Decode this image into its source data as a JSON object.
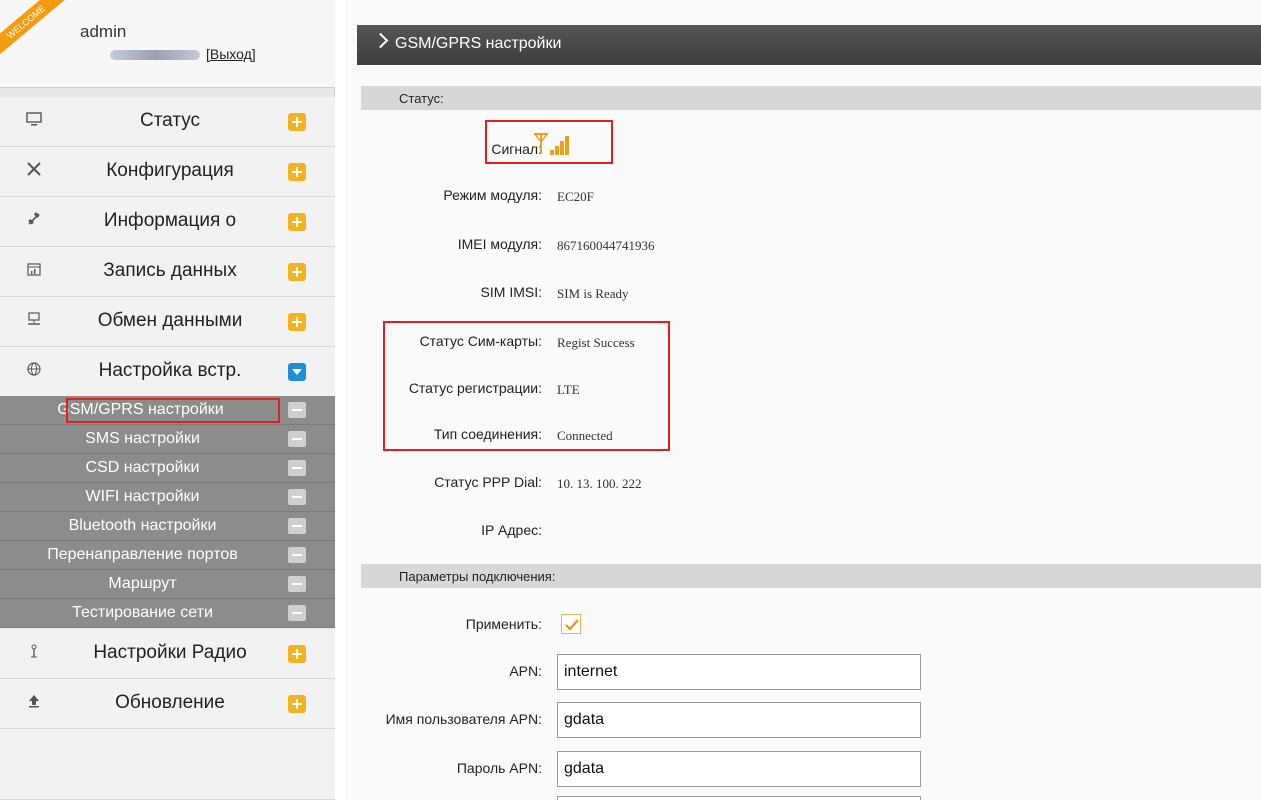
{
  "user": {
    "welcome_badge": "WELCOME",
    "name": "admin",
    "logout_label": "[Выход]"
  },
  "sidebar": {
    "items": [
      {
        "label": "Статус",
        "icon": "monitor-icon"
      },
      {
        "label": "Конфигурация",
        "icon": "tools-icon"
      },
      {
        "label": "Информация о",
        "icon": "satellite-icon"
      },
      {
        "label": "Запись данных",
        "icon": "calendar-chart-icon"
      },
      {
        "label": "Обмен данными",
        "icon": "network-icon"
      },
      {
        "label": "Настройка встр.",
        "icon": "globe-icon"
      }
    ],
    "subitems": [
      {
        "label": "GSM/GPRS настройки"
      },
      {
        "label": "SMS настройки"
      },
      {
        "label": "CSD настройки"
      },
      {
        "label": "WIFI настройки"
      },
      {
        "label": "Bluetooth настройки"
      },
      {
        "label": "Перенаправление портов"
      },
      {
        "label": "Маршрут"
      },
      {
        "label": "Тестирование сети"
      }
    ],
    "bottom_items": [
      {
        "label": "Настройки Радио",
        "icon": "radio-antenna-icon"
      },
      {
        "label": "Обновление",
        "icon": "upload-icon"
      }
    ]
  },
  "page": {
    "title": "GSM/GPRS настройки"
  },
  "status_section": {
    "header": "Статус:",
    "signal_label": "Сигнал:",
    "fields": [
      {
        "label": "Режим модуля:",
        "value": "EC20F"
      },
      {
        "label": "IMEI модуля:",
        "value": "867160044741936"
      },
      {
        "label": "SIM IMSI:",
        "value": "SIM is Ready"
      },
      {
        "label": "Статус Сим-карты:",
        "value": "Regist Success"
      },
      {
        "label": "Статус регистрации:",
        "value": "LTE"
      },
      {
        "label": "Тип соединения:",
        "value": "Connected"
      },
      {
        "label": "Статус PPP Dial:",
        "value": "10. 13. 100. 222"
      },
      {
        "label": "IP Адрес:",
        "value": ""
      }
    ]
  },
  "connection_section": {
    "header": "Параметры подключения:",
    "apply_label": "Применить:",
    "apply_checked": true,
    "apn_label": "APN:",
    "apn_value": "internet",
    "apn_user_label": "Имя пользователя APN:",
    "apn_user_value": "gdata",
    "apn_password_label": "Пароль APN:",
    "apn_password_value": "gdata"
  },
  "colors": {
    "accent_orange": "#f5b21f",
    "accent_blue": "#1f8fd8",
    "highlight_red": "#e02020",
    "signal_orange": "#e8a11a"
  }
}
